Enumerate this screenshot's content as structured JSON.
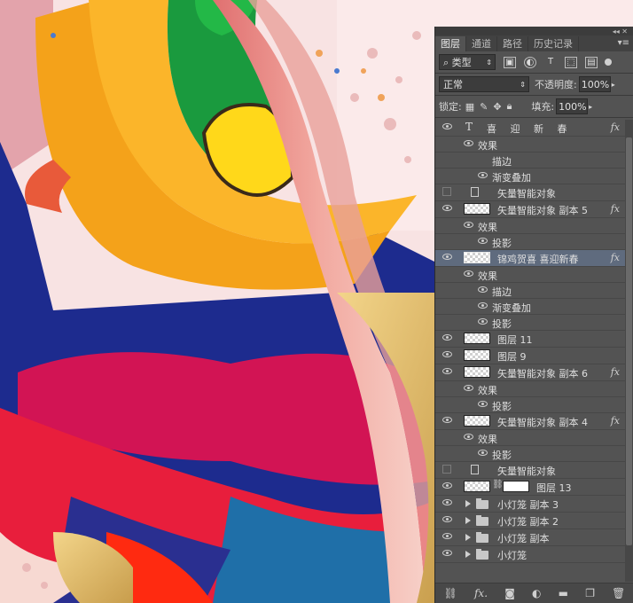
{
  "panel": {
    "tabs": [
      "图层",
      "通道",
      "路径",
      "历史记录"
    ],
    "active_tab": "图层",
    "filter_kind": "类型",
    "blend_mode": "正常",
    "opacity_label": "不透明度:",
    "opacity_value": "100%",
    "lock_label": "锁定:",
    "fill_label": "填充:",
    "fill_value": "100%"
  },
  "layers": [
    {
      "type": "text",
      "name": "喜 迎 新 春",
      "fx": "fx",
      "visible": true
    },
    {
      "type": "effect",
      "name": "效果",
      "indent": 1
    },
    {
      "type": "effect",
      "name": "描边",
      "indent": 2,
      "noeye": true
    },
    {
      "type": "effect",
      "name": "渐变叠加",
      "indent": 2
    },
    {
      "type": "smart",
      "name": "矢量智能对象",
      "visible": false
    },
    {
      "type": "layer",
      "name": "矢量智能对象 副本 5",
      "fx": "fx",
      "visible": true
    },
    {
      "type": "effect",
      "name": "效果",
      "indent": 1
    },
    {
      "type": "effect",
      "name": "投影",
      "indent": 2
    },
    {
      "type": "layer",
      "name": "锦鸡贺喜  喜迎新春",
      "fx": "fx",
      "visible": true,
      "selected": true
    },
    {
      "type": "effect",
      "name": "效果",
      "indent": 1
    },
    {
      "type": "effect",
      "name": "描边",
      "indent": 2
    },
    {
      "type": "effect",
      "name": "渐变叠加",
      "indent": 2
    },
    {
      "type": "effect",
      "name": "投影",
      "indent": 2
    },
    {
      "type": "layer",
      "name": "图层 11",
      "visible": true
    },
    {
      "type": "layer",
      "name": "图层 9",
      "visible": true
    },
    {
      "type": "layer",
      "name": "矢量智能对象 副本 6",
      "fx": "fx",
      "visible": true
    },
    {
      "type": "effect",
      "name": "效果",
      "indent": 1
    },
    {
      "type": "effect",
      "name": "投影",
      "indent": 2
    },
    {
      "type": "layer",
      "name": "矢量智能对象 副本 4",
      "fx": "fx",
      "visible": true
    },
    {
      "type": "effect",
      "name": "效果",
      "indent": 1
    },
    {
      "type": "effect",
      "name": "投影",
      "indent": 2
    },
    {
      "type": "smart",
      "name": "矢量智能对象",
      "visible": false
    },
    {
      "type": "mask",
      "name": "图层 13",
      "visible": true
    },
    {
      "type": "group",
      "name": "小灯笼 副本 3",
      "visible": true
    },
    {
      "type": "group",
      "name": "小灯笼 副本 2",
      "visible": true
    },
    {
      "type": "group",
      "name": "小灯笼 副本",
      "visible": true
    },
    {
      "type": "group",
      "name": "小灯笼",
      "visible": true
    }
  ],
  "bottom_icons": [
    "link-icon",
    "fx-icon",
    "mask-icon",
    "adjustment-icon",
    "folder-icon",
    "new-layer-icon",
    "trash-icon"
  ],
  "colors": {
    "panel": "#535353",
    "selected": "#5f6b7e"
  }
}
